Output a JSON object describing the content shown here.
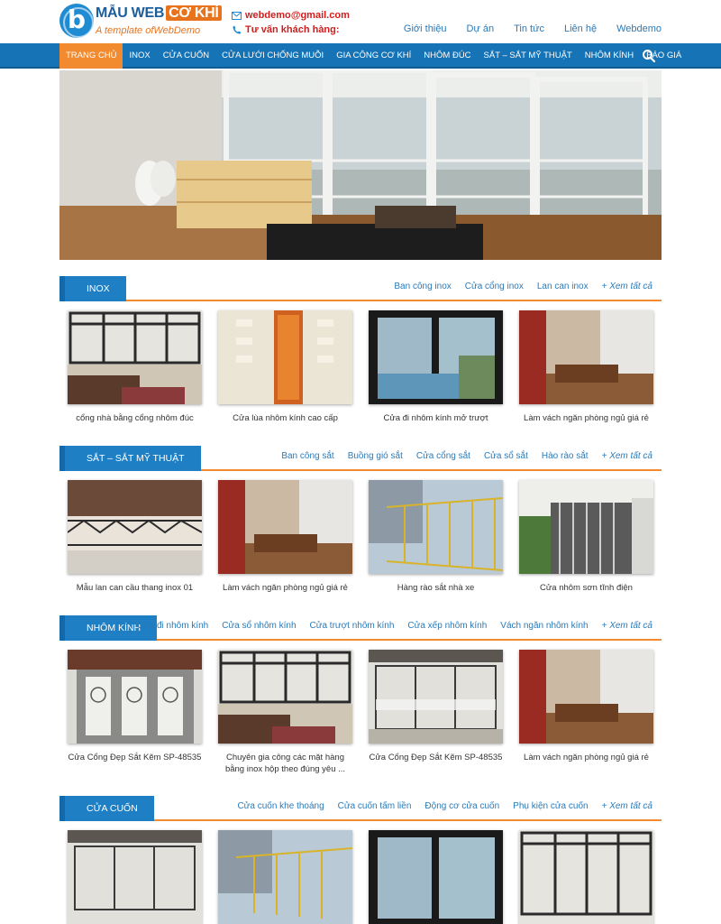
{
  "header": {
    "logo": {
      "text_main": "MẪU WEB",
      "text_highlight": "CƠ KHÍ",
      "tagline": "A template ofWebDemo"
    },
    "email": "webdemo@gmail.com",
    "hotline_label": "Tư vấn khách hàng:",
    "links": [
      "Giới thiệu",
      "Dự án",
      "Tin tức",
      "Liên hệ",
      "Webdemo"
    ]
  },
  "nav": {
    "items": [
      "TRANG CHỦ",
      "INOX",
      "CỬA CUỐN",
      "CỬA LƯỚI CHỐNG MUỖI",
      "GIA CÔNG CƠ KHÍ",
      "NHÔM ĐÚC",
      "SẮT – SẮT MỸ THUẬT",
      "NHÔM KÍNH",
      "BÁO GIÁ"
    ],
    "search_icon": "search-icon"
  },
  "sections": [
    {
      "title": "INOX",
      "links": [
        "Ban công inox",
        "Cửa cổng inox",
        "Lan can inox",
        "+ Xem tất cả"
      ],
      "products": [
        "cổng nhà bằng cổng nhôm đúc",
        "Cửa lùa nhôm kính cao cấp",
        "Cửa đi nhôm kính mở trượt",
        "Làm vách ngăn phòng ngủ giá rẻ"
      ]
    },
    {
      "title": "SẮT – SẮT MỸ THUẬT",
      "links": [
        "Ban công sắt",
        "Buồng gió sắt",
        "Cửa cổng sắt",
        "Cửa sổ sắt",
        "Hào rào sắt",
        "+ Xem tất cả"
      ],
      "products": [
        "Mẫu lan can cầu thang inox 01",
        "Làm vách ngăn phòng ngủ giá rẻ",
        "Hàng rào sắt nhà xe",
        "Cửa nhôm sơn tĩnh điện"
      ]
    },
    {
      "title": "NHÔM KÍNH",
      "links": [
        "Cửa đi nhôm kính",
        "Cửa sổ nhôm kính",
        "Cửa trượt nhôm kính",
        "Cửa xếp nhôm kính",
        "Vách ngăn nhôm kính",
        "+ Xem tất cả"
      ],
      "products": [
        "Cửa Cổng Đẹp Sắt Kẽm SP-48535",
        "Chuyên gia công các mặt hàng bằng inox hộp theo đúng yêu ...",
        "Cửa Cổng Đẹp Sắt Kẽm SP-48535",
        "Làm vách ngăn phòng ngủ giá rẻ"
      ]
    },
    {
      "title": "CỬA CUỐN",
      "links": [
        "Cửa cuốn khe thoáng",
        "Cửa cuốn tấm liền",
        "Động cơ cửa cuốn",
        "Phụ kiện cửa cuốn",
        "+ Xem tất cả"
      ],
      "products": []
    }
  ],
  "colors": {
    "primary": "#1e7fc4",
    "accent": "#f28a30",
    "link": "#2a7ab8",
    "email": "#d21d1d"
  }
}
